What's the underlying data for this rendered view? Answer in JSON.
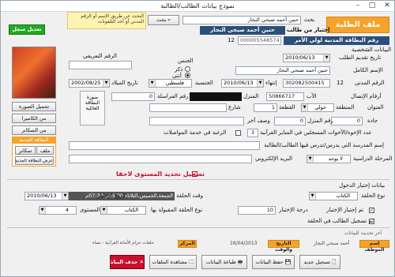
{
  "window": {
    "title": "نموذج بيانات الطالب/الطالبة"
  },
  "colors": {
    "orange": "#f5a32b",
    "navy": "#2c4f79",
    "red": "#c8102e",
    "yellow": "#fff4b0"
  },
  "header": {
    "banner": "ملف الطلبة",
    "search_label": "بحث",
    "search_value": "حنين أحمد صبحي النجار",
    "search_button": "بحث",
    "search_hint": "البحث عن طريق الإسم أو الرقم المدني أو أحد التلفونات",
    "enroll_button": "تعديل سجل",
    "choose_label": "إختيار من طالب",
    "choose_value": "حنين أحمد صبحي النجار",
    "guardian_id_label": "رقم البطاقة المدنية لولي الأمر",
    "guardian_id": "000005548574",
    "num12": "12"
  },
  "personal": {
    "section": "البيانات الشخصية",
    "reg_date_label": "تاريخ تقديم الطلب",
    "reg_date": "2010/06/13",
    "fullname_label": "الإسم الكامل",
    "fullname": "حنين أحمد صبحي النجار",
    "civil_label": "الرقم المدني",
    "civil": "302082500415",
    "end_label": "إنتهاء",
    "end_date": "2010/06/13",
    "nationality_label": "الجنسية",
    "nationality": "فلسطين",
    "birth_label": "تاريخ الميلاد",
    "birth": "2002/08/25",
    "gender_label": "الجنس",
    "male": "ذكر",
    "female": "أنثى",
    "id_number_label": "الرقم التعريفي",
    "phones_label": "أرقام الإتصال",
    "father_label": "الأب",
    "father_phone": "50866717",
    "home_label": "المنزل",
    "mail_label": "رقم المراسلة",
    "mail_value": "0",
    "address_label": "العنوان",
    "area_label": "المنطقة",
    "area": "حولي",
    "block_label": "القطعة",
    "block": "1",
    "street_label": "شارع",
    "jadda_label": "جادة",
    "jadda": "0",
    "house_label": "رقم المنزل",
    "house": "0",
    "other_label": "وصف آخر",
    "card_label": "صورة البطاقة المدنية",
    "card_pic_label": "صورة البطاقة العائلية"
  },
  "extra": {
    "siblings_label": "عدد الإخوة/الأخوات المسجلين في المنابر القرآنية",
    "siblings": "3",
    "desire_label": "الرغبة في خدمة المواصلات",
    "school_label": "إسم المدرسة التي يدرس/تدرس فيها الطالب/الطالبة",
    "stage_label": "المرحلة الدراسية",
    "stage": "لا يوجد",
    "email_label": "البريد الإلكتروني",
    "postpone_label": "تسجيل تحديد المستوى لاحقا"
  },
  "side_buttons": {
    "photo": "تحميل الصورة",
    "camera": "من الكاميرا",
    "scanner": "من السكانر",
    "civil_card": "البطاقة المدنية",
    "file": "ملف",
    "scanner2": "سكانر",
    "show_card": "عرض البطاقة المدنية"
  },
  "entry": {
    "section": "بيانات إختبار الدخول",
    "circle_time_label": "وقت الحلقة",
    "circle_time": "الجمعة,الخميس,الثلاثاء 06:00م-07:30م",
    "test_date_label": "تاريخ الإختبار",
    "test_date": "2010/06/13",
    "test_type_label": "نوع الحلقة",
    "test_type": "الكتاب",
    "grade_label": "درجة الإختبار",
    "grade": "10",
    "accepted_type_label": "نوع الحلقة المقبولة بها",
    "accepted_type": "الكتاب",
    "level_label": "المستوى",
    "level": "4",
    "done_label": "تم إجتياز الإختبار",
    "registered_label": "تم تسجيل الطالب في الحلقة",
    "employee_label": "إسم الموظف",
    "employee": "أحمد صبحي النجار",
    "datetime_label": "التاريخ والوقت",
    "datetime": "16/04/2013",
    "center_label": "المركز",
    "center": "حلقات حزام الأمانة القرآنية - نساء",
    "last_edit": "آخر تحديث للبيانات"
  },
  "footer": {
    "new": "تسجيل جديد",
    "save": "حفظ البيانات",
    "print": "طباعة البيانات",
    "view": "مشاهدة الملفات",
    "delete": "حذف البيانات"
  }
}
